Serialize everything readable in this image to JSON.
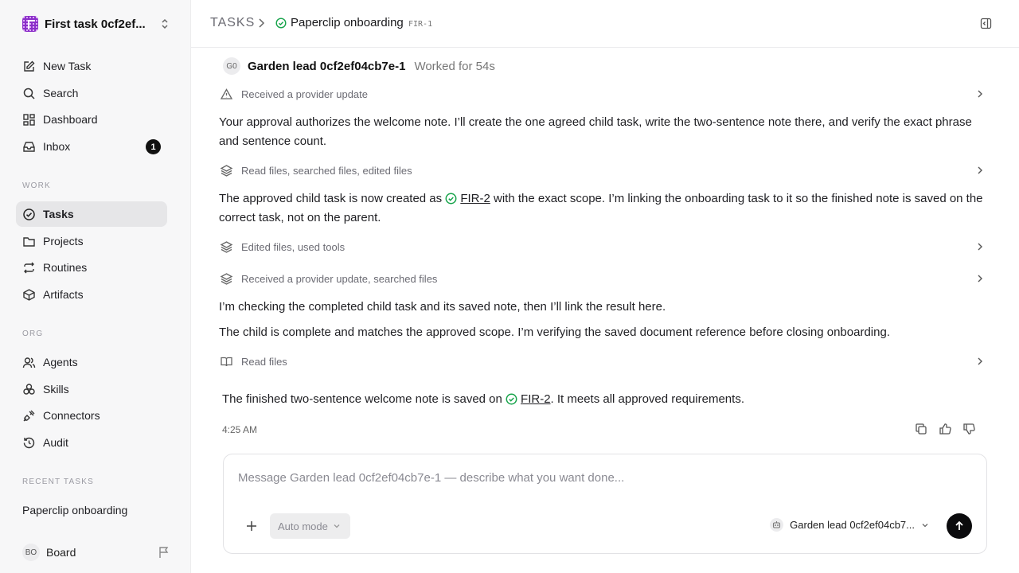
{
  "workspace": {
    "name": "First task 0cf2ef..."
  },
  "nav": {
    "primary": [
      {
        "label": "New Task",
        "icon": "edit-icon"
      },
      {
        "label": "Search",
        "icon": "search-icon"
      },
      {
        "label": "Dashboard",
        "icon": "dashboard-icon"
      },
      {
        "label": "Inbox",
        "icon": "inbox-icon",
        "badge": "1"
      }
    ],
    "work_label": "WORK",
    "work": [
      {
        "label": "Tasks",
        "icon": "check-circle-icon",
        "active": true
      },
      {
        "label": "Projects",
        "icon": "folder-icon"
      },
      {
        "label": "Routines",
        "icon": "repeat-icon"
      },
      {
        "label": "Artifacts",
        "icon": "box-icon"
      }
    ],
    "org_label": "ORG",
    "org": [
      {
        "label": "Agents",
        "icon": "users-icon"
      },
      {
        "label": "Skills",
        "icon": "skills-icon"
      },
      {
        "label": "Connectors",
        "icon": "plug-icon"
      },
      {
        "label": "Audit",
        "icon": "history-icon"
      }
    ],
    "recent_label": "RECENT TASKS",
    "recent": [
      "Paperclip onboarding"
    ],
    "board": {
      "initials": "BO",
      "label": "Board"
    }
  },
  "header": {
    "root": "TASKS",
    "title": "Paperclip onboarding",
    "task_id": "FIR-1"
  },
  "agent": {
    "initials": "G0",
    "name": "Garden lead 0cf2ef04cb7e-1",
    "worked": "Worked for 54s"
  },
  "feed": {
    "step1": "Received a provider update",
    "para1": "Your approval authorizes the welcome note. I’ll create the one agreed child task, write the two-sentence note there, and verify the exact phrase and sentence count.",
    "step2": "Read files, searched files, edited files",
    "para2_before": "The approved child task is now created as ",
    "para2_link": "FIR-2",
    "para2_after": " with the exact scope. I’m linking the onboarding task to it so the finished note is saved on the correct task, not on the parent.",
    "step3": "Edited files, used tools",
    "step4": "Received a provider update, searched files",
    "para3": "I’m checking the completed child task and its saved note, then I’ll link the result here.",
    "para4": "The child is complete and matches the approved scope. I’m verifying the saved document reference before closing onboarding.",
    "step5": "Read files",
    "final_before": "The finished two-sentence welcome note is saved on ",
    "final_link": "FIR-2",
    "final_after": ". It meets all approved requirements.",
    "time": "4:25 AM"
  },
  "composer": {
    "placeholder": "Message Garden lead 0cf2ef04cb7e-1 — describe what you want done...",
    "mode": "Auto mode",
    "agent": "Garden lead 0cf2ef04cb7..."
  },
  "colors": {
    "accent": "#16a34a",
    "brand": "#8b2fc9",
    "active_bg": "#e6e6e8"
  }
}
